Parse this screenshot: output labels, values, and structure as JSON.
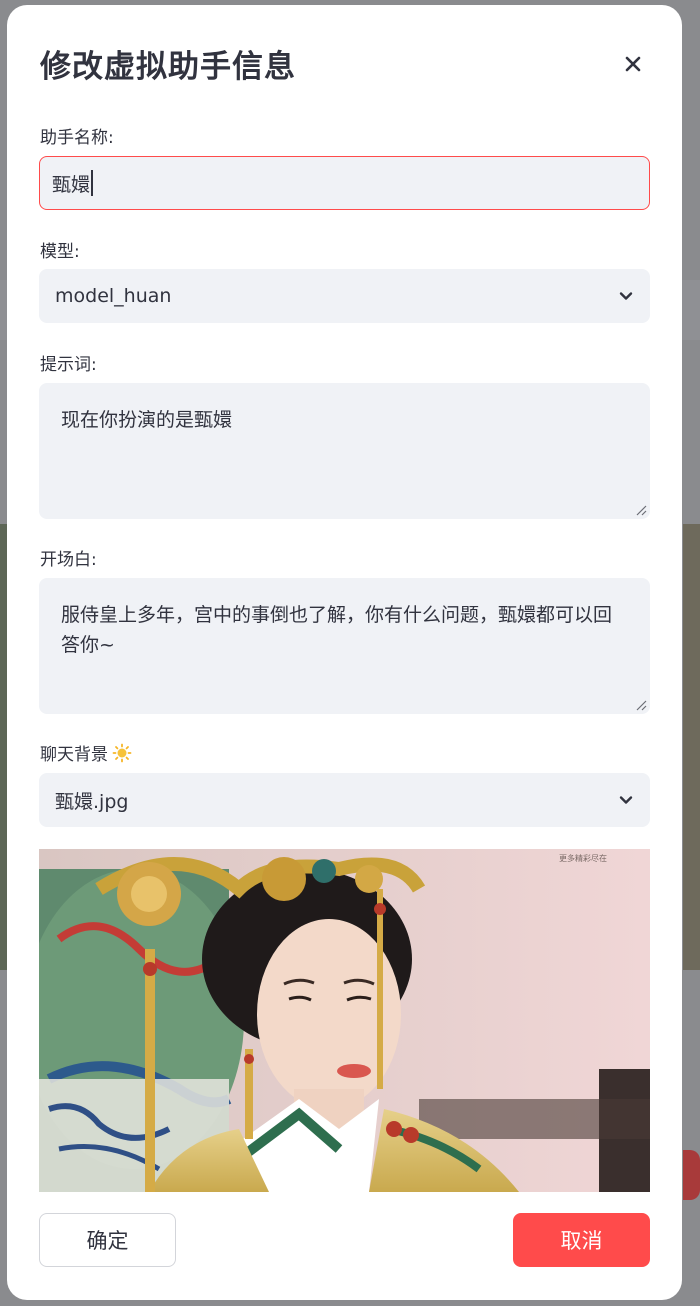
{
  "modal": {
    "title": "修改虚拟助手信息",
    "close_icon": "close-icon"
  },
  "fields": {
    "name": {
      "label": "助手名称:",
      "value": "甄嬛"
    },
    "model": {
      "label": "模型:",
      "selected": "model_huan",
      "icon": "chevron-down-icon"
    },
    "prompt": {
      "label": "提示词:",
      "value": "现在你扮演的是甄嬛"
    },
    "opening": {
      "label": "开场白:",
      "value": "服侍皇上多年，宫中的事倒也了解，你有什么问题，甄嬛都可以回答你~"
    },
    "background": {
      "label": "聊天背景",
      "label_icon": "sun-icon",
      "selected": "甄嬛.jpg",
      "icon": "chevron-down-icon",
      "preview_watermark": "更多精彩尽在"
    }
  },
  "buttons": {
    "confirm": "确定",
    "cancel": "取消"
  },
  "colors": {
    "accent": "#ff4b4b",
    "input_bg": "#f0f2f6",
    "text": "#31333f"
  }
}
